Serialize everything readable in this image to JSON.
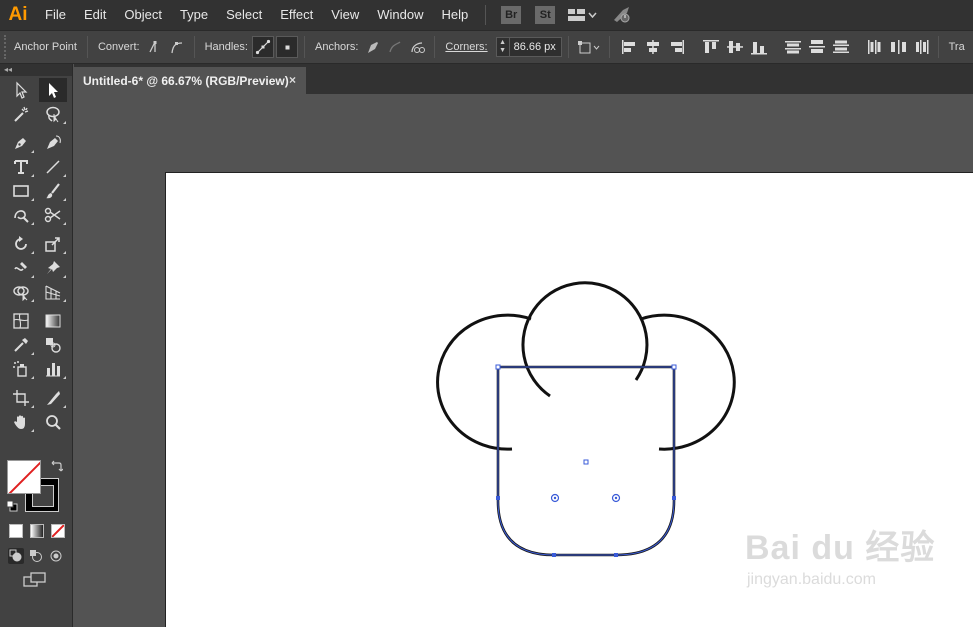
{
  "app": {
    "logo": "Ai"
  },
  "menu": {
    "items": [
      "File",
      "Edit",
      "Object",
      "Type",
      "Select",
      "Effect",
      "View",
      "Window",
      "Help"
    ],
    "bridge": "Br",
    "stock": "St"
  },
  "control": {
    "tool_name": "Anchor Point",
    "convert_label": "Convert:",
    "handles_label": "Handles:",
    "anchors_label": "Anchors:",
    "corners_label": "Corners:",
    "corners_value": "86.66 px",
    "tr_label": "Tra"
  },
  "panel": {
    "collapse": "◂◂"
  },
  "document": {
    "tab_title": "Untitled-6* @ 66.67% (RGB/Preview)",
    "close": "×"
  },
  "watermark": {
    "main": "Bai du 经验",
    "sub": "jingyan.baidu.com"
  },
  "colors": {
    "accent": "#ff9a00",
    "selection": "#3a5bd8",
    "artboard": "#ffffff",
    "pasteboard": "#535353"
  }
}
